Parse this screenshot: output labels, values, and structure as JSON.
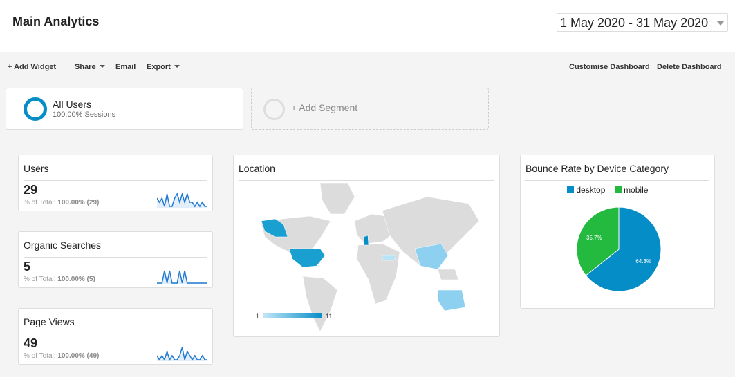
{
  "header": {
    "title": "Main Analytics",
    "date_range": "1 May 2020 - 31 May 2020"
  },
  "toolbar": {
    "add_widget": "+ Add Widget",
    "share": "Share",
    "email": "Email",
    "export": "Export",
    "customise": "Customise Dashboard",
    "delete": "Delete Dashboard"
  },
  "segments": {
    "active": {
      "name": "All Users",
      "sub": "100.00% Sessions"
    },
    "add": "+ Add Segment"
  },
  "metrics": [
    {
      "title": "Users",
      "value": "29",
      "pct_label": "% of Total:",
      "pct": "100.00% (29)",
      "spark": [
        2,
        1,
        2,
        0,
        3,
        0,
        0,
        2,
        3,
        1,
        3,
        1,
        3,
        1,
        1,
        0,
        1,
        0,
        1,
        0,
        0
      ]
    },
    {
      "title": "Organic Searches",
      "value": "5",
      "pct_label": "% of Total:",
      "pct": "100.00% (5)",
      "spark": [
        0,
        0,
        0,
        1,
        0,
        1,
        0,
        0,
        0,
        1,
        0,
        1,
        0,
        0,
        0,
        0,
        0,
        0,
        0,
        0,
        0
      ]
    },
    {
      "title": "Page Views",
      "value": "49",
      "pct_label": "% of Total:",
      "pct": "100.00% (49)",
      "spark": [
        1,
        0,
        1,
        0,
        2,
        0,
        1,
        0,
        0,
        1,
        3,
        0,
        2,
        1,
        0,
        1,
        0,
        0,
        1,
        0,
        0
      ]
    }
  ],
  "location": {
    "title": "Location",
    "legend_min": "1",
    "legend_max": "11"
  },
  "chart_data": {
    "type": "pie",
    "title": "Bounce Rate by Device Category",
    "categories": [
      "desktop",
      "mobile"
    ],
    "values": [
      64.3,
      35.7
    ],
    "labels": [
      "64.3%",
      "35.7%"
    ],
    "colors": [
      "#058dc7",
      "#24b93f"
    ],
    "legend": "top"
  }
}
